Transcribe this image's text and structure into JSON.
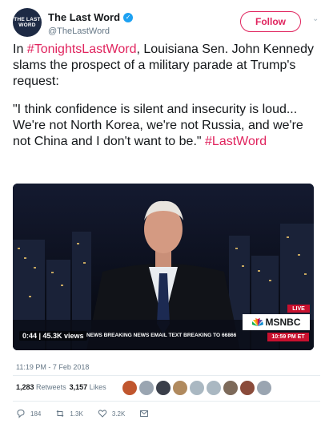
{
  "account": {
    "display_name": "The Last Word",
    "handle": "@TheLastWord",
    "avatar_text": "THE LAST WORD",
    "follow_label": "Follow"
  },
  "tweet": {
    "line1_prefix": "In ",
    "hashtag1": "#TonightsLastWord",
    "line1_rest": ", Louisiana Sen. John Kennedy slams the prospect of a military parade at Trump's request:",
    "quote": "\"I think confidence is silent and insecurity is loud... We're not North Korea, we're not Russia,  and we're not China and I don't want to be.\" ",
    "hashtag2": "#LastWord"
  },
  "video": {
    "view_count": "0:44 | 45.3K views",
    "ticker": "NEWS BREAKING NEWS EMAIL TEXT BREAKING TO 66866",
    "time": "10:59 PM ET",
    "live": "LIVE",
    "network": "MSNBC"
  },
  "meta": {
    "timestamp": "11:19 PM - 7 Feb 2018",
    "retweets_count": "1,283",
    "retweets_label": "Retweets",
    "likes_count": "3,157",
    "likes_label": "Likes"
  },
  "actions": {
    "replies": "184",
    "retweets": "1.3K",
    "likes": "3.2K"
  },
  "colors": {
    "accent": "#e0245e",
    "verified": "#1da1f2",
    "muted": "#657786"
  }
}
